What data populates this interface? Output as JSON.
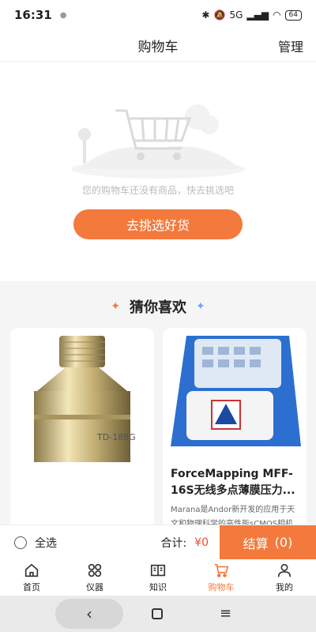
{
  "status_bar": {
    "time": "16:31",
    "battery": "64",
    "network": "5G"
  },
  "nav": {
    "title": "购物车",
    "action": "管理"
  },
  "empty": {
    "message": "您的购物车还没有商品，快去挑选吧",
    "button": "去挑选好货"
  },
  "recommend": {
    "title": "猜你喜欢",
    "products": [
      {
        "image": "brass-sensor",
        "title": "",
        "description": ""
      },
      {
        "image": "pressure-mat",
        "title": "ForceMapping MFF-16S无线多点薄膜压力...",
        "description": "Marana是Andor新开发的应用于天文和物理科学的高性能sCMOS相机"
      }
    ]
  },
  "checkout": {
    "select_all": "全选",
    "total_label": "合计:",
    "total_value": "¥0",
    "settle": "结算",
    "count": "(0)"
  },
  "tabs": [
    {
      "label": "首页",
      "icon": "home-icon"
    },
    {
      "label": "仪器",
      "icon": "grid-icon"
    },
    {
      "label": "知识",
      "icon": "book-icon"
    },
    {
      "label": "购物车",
      "icon": "cart-icon",
      "active": true
    },
    {
      "label": "我的",
      "icon": "user-icon"
    }
  ],
  "colors": {
    "accent": "#f37a3c",
    "price": "#f24a2f"
  }
}
